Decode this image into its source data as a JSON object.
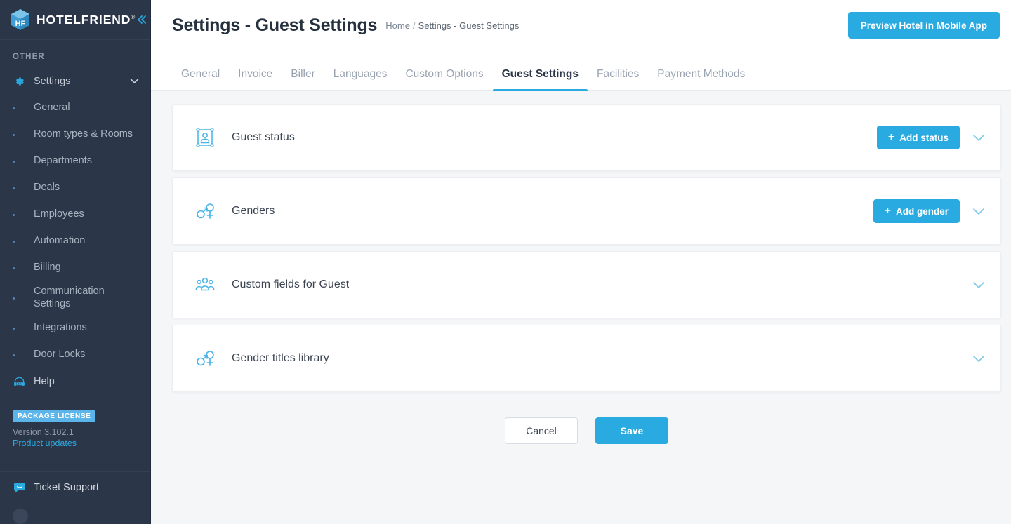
{
  "sidebar": {
    "brand": {
      "name": "HOTELFRIEND",
      "trademark": "®",
      "logo_icon": "hotelfriend-cube-logo"
    },
    "collapse_icon": "double-chevron-left-icon",
    "section_label": "OTHER",
    "settings": {
      "label": "Settings",
      "icon": "gear-icon",
      "caret_icon": "chevron-down-icon"
    },
    "items": [
      {
        "label": "General"
      },
      {
        "label": "Room types & Rooms"
      },
      {
        "label": "Departments"
      },
      {
        "label": "Deals"
      },
      {
        "label": "Employees"
      },
      {
        "label": "Automation"
      },
      {
        "label": "Billing"
      },
      {
        "label": "Communication Settings"
      },
      {
        "label": "Integrations"
      },
      {
        "label": "Door Locks"
      }
    ],
    "help": {
      "label": "Help",
      "icon": "headset-support-icon"
    },
    "license": {
      "badge": "PACKAGE LICENSE",
      "version": "Version 3.102.1",
      "updates_link": "Product updates"
    },
    "ticket_support": {
      "label": "Ticket Support",
      "icon": "chat-bubble-icon"
    }
  },
  "header": {
    "title": "Settings - Guest Settings",
    "breadcrumb": {
      "home": "Home",
      "separator": "/",
      "current": "Settings - Guest Settings"
    },
    "preview_button": "Preview Hotel in Mobile App"
  },
  "tabs": [
    {
      "label": "General",
      "active": false
    },
    {
      "label": "Invoice",
      "active": false
    },
    {
      "label": "Biller",
      "active": false
    },
    {
      "label": "Languages",
      "active": false
    },
    {
      "label": "Custom Options",
      "active": false
    },
    {
      "label": "Guest Settings",
      "active": true
    },
    {
      "label": "Facilities",
      "active": false
    },
    {
      "label": "Payment Methods",
      "active": false
    }
  ],
  "cards": [
    {
      "title": "Guest status",
      "icon": "guest-status-person-frame-icon",
      "action_label": "Add status",
      "has_action": true,
      "chevron_icon": "chevron-down-icon"
    },
    {
      "title": "Genders",
      "icon": "gender-symbols-icon",
      "action_label": "Add gender",
      "has_action": true,
      "chevron_icon": "chevron-down-icon"
    },
    {
      "title": "Custom fields for Guest",
      "icon": "people-group-icon",
      "action_label": "",
      "has_action": false,
      "chevron_icon": "chevron-down-icon"
    },
    {
      "title": "Gender titles library",
      "icon": "gender-symbols-icon",
      "action_label": "",
      "has_action": false,
      "chevron_icon": "chevron-down-icon"
    }
  ],
  "footer_actions": {
    "cancel": "Cancel",
    "save": "Save"
  },
  "colors": {
    "accent": "#29abe2",
    "sidebar_bg": "#2b3648",
    "page_bg": "#f5f6f8",
    "title": "#26313f"
  }
}
